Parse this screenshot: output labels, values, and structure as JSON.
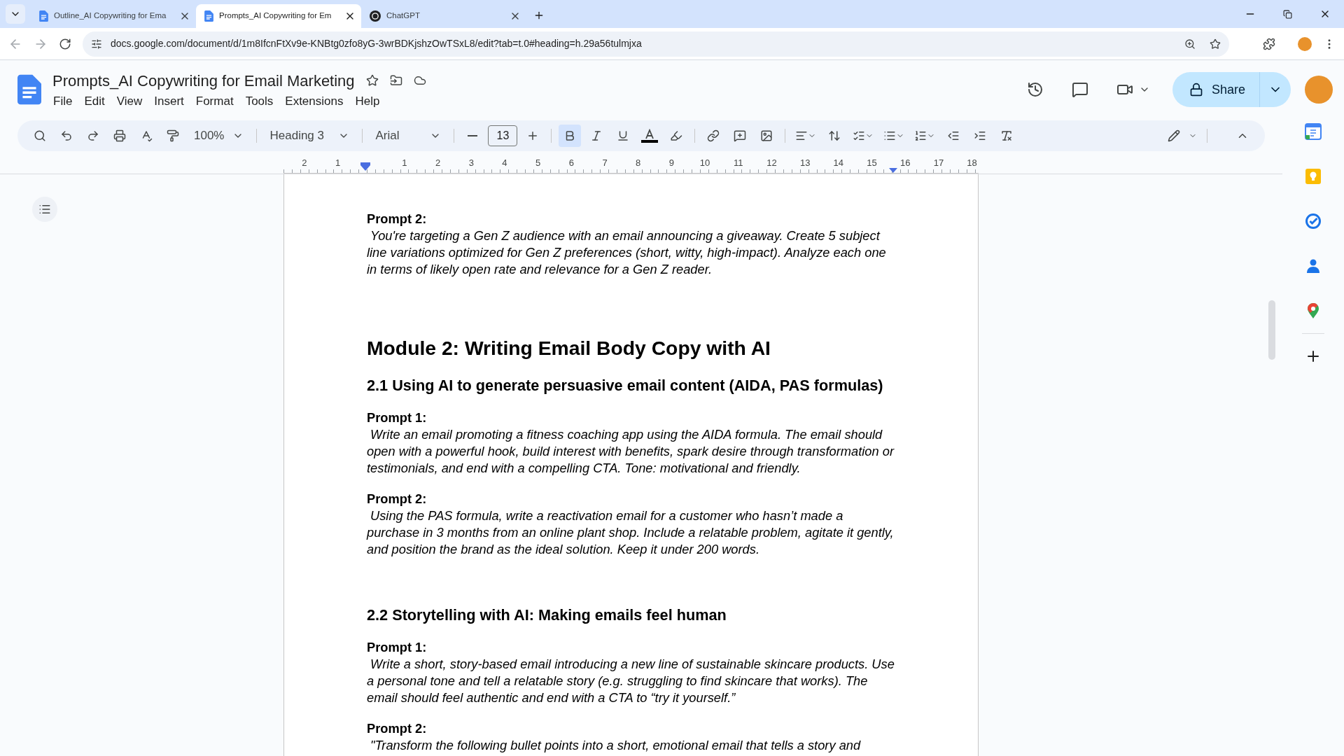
{
  "browser": {
    "tabs": [
      {
        "title": "Outline_AI Copywriting for Ema",
        "kind": "docs",
        "selected": false
      },
      {
        "title": "Prompts_AI Copywriting for Em",
        "kind": "docs",
        "selected": true
      },
      {
        "title": "ChatGPT",
        "kind": "chat",
        "selected": false
      }
    ],
    "url": "docs.google.com/document/d/1m8IfcnFtXv9e-KNBtg0zfo8yG-3wrBDKjshzOwTSxL8/edit?tab=t.0#heading=h.29a56tulmjxa"
  },
  "docs": {
    "title": "Prompts_AI Copywriting for Email Marketing",
    "menus": [
      "File",
      "Edit",
      "View",
      "Insert",
      "Format",
      "Tools",
      "Extensions",
      "Help"
    ],
    "share": "Share",
    "toolbar": {
      "zoom": "100%",
      "style": "Heading 3",
      "font": "Arial",
      "size": "13",
      "bold": true,
      "italic": false,
      "underline": false
    },
    "ruler": {
      "left_numbers": [
        "2",
        "1"
      ],
      "right_numbers": [
        "1",
        "2",
        "3",
        "4",
        "5",
        "6",
        "7",
        "8",
        "9",
        "10",
        "11",
        "12",
        "13",
        "14",
        "15",
        "16",
        "17",
        "18"
      ]
    },
    "blocks": [
      {
        "kind": "label",
        "text": "Prompt 2:"
      },
      {
        "kind": "body",
        "text": "You're targeting a Gen Z audience with an email announcing a giveaway. Create 5 subject line variations optimized for Gen Z preferences (short, witty, high-impact). Analyze each one in terms of likely open rate and relevance for a Gen Z reader."
      },
      {
        "kind": "h1",
        "text": "Module 2: Writing Email Body Copy with AI"
      },
      {
        "kind": "h2",
        "text": "2.1 Using AI to generate persuasive email content (AIDA, PAS formulas)"
      },
      {
        "kind": "label",
        "text": "Prompt 1:"
      },
      {
        "kind": "body",
        "text": "Write an email promoting a fitness coaching app using the AIDA formula. The email should open with a powerful hook, build interest with benefits, spark desire through transformation or testimonials, and end with a compelling CTA. Tone: motivational and friendly."
      },
      {
        "kind": "label",
        "text": "Prompt 2:"
      },
      {
        "kind": "body",
        "text": "Using the PAS formula, write a reactivation email for a customer who hasn’t made a purchase in 3 months from an online plant shop. Include a relatable problem, agitate it gently, and position the brand as the ideal solution. Keep it under 200 words."
      },
      {
        "kind": "h2",
        "text": "2.2 Storytelling with AI: Making emails feel human"
      },
      {
        "kind": "label",
        "text": "Prompt 1:"
      },
      {
        "kind": "body",
        "text": "Write a short, story-based email introducing a new line of sustainable skincare products. Use a personal tone and tell a relatable story (e.g. struggling to find skincare that works). The email should feel authentic and end with a CTA to “try it yourself.”"
      },
      {
        "kind": "label",
        "text": "Prompt 2:"
      },
      {
        "kind": "body",
        "text": "\"Transform the following bullet points into a short, emotional email that tells a story and"
      }
    ]
  }
}
